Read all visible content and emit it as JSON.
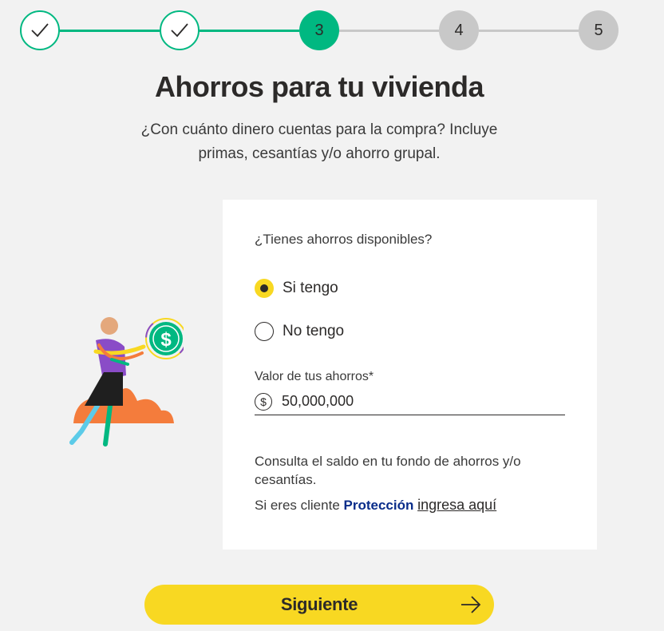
{
  "stepper": {
    "steps": [
      {
        "label": "",
        "state": "done"
      },
      {
        "label": "",
        "state": "done"
      },
      {
        "label": "3",
        "state": "active"
      },
      {
        "label": "4",
        "state": "todo"
      },
      {
        "label": "5",
        "state": "todo"
      }
    ],
    "icons": {
      "done": "check-icon"
    }
  },
  "header": {
    "title": "Ahorros para tu vivienda",
    "subtitle_line1": "¿Con cuánto dinero cuentas para la compra? Incluye",
    "subtitle_line2": "primas, cesantías y/o ahorro grupal."
  },
  "form": {
    "question": "¿Tienes ahorros disponibles?",
    "options": [
      {
        "label": "Si tengo",
        "selected": true
      },
      {
        "label": "No tengo",
        "selected": false
      }
    ],
    "savings": {
      "label": "Valor de tus ahorros*",
      "currency_symbol": "$",
      "value": "50,000,000"
    },
    "note": "Consulta el saldo en tu fondo de ahorros y/o cesantías.",
    "client_prefix": "Si eres cliente",
    "brand": "Protección",
    "link": "ingresa aquí"
  },
  "footer": {
    "next_label": "Siguiente",
    "next_icon": "arrow-right-icon"
  },
  "colors": {
    "accent_green": "#00b881",
    "accent_yellow": "#f8d822",
    "brand_blue": "#0a2d8a",
    "step_todo": "#c8c8c8",
    "background": "#f2f2f2"
  }
}
